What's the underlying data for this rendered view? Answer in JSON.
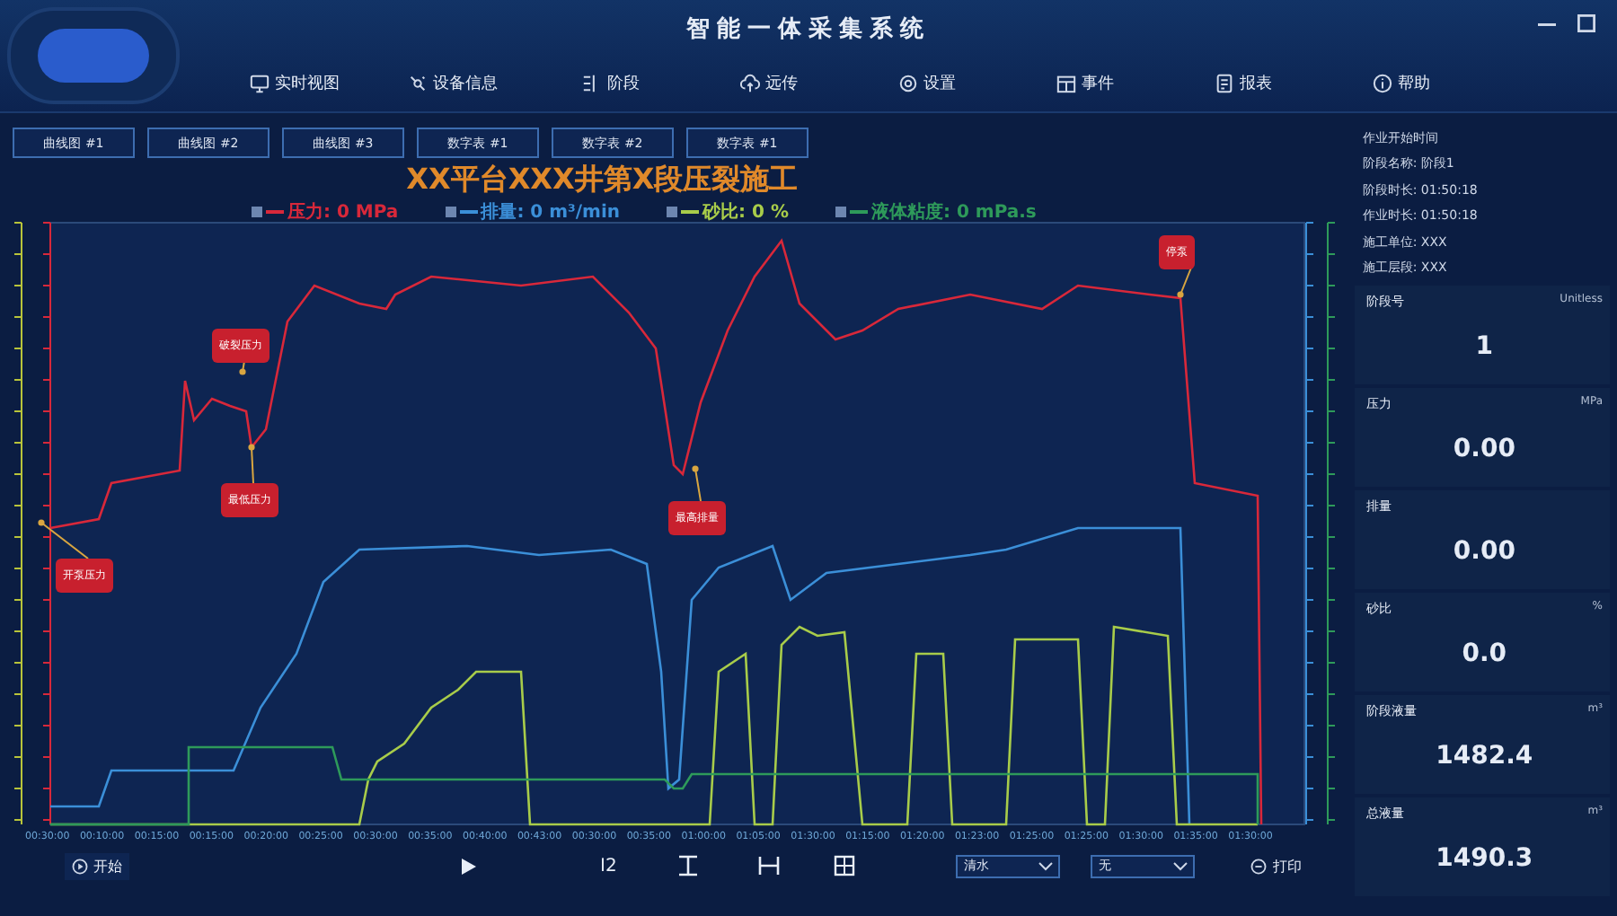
{
  "window": {
    "title": "智能一体采集系统"
  },
  "nav": [
    {
      "label": "实时视图",
      "selected": false
    },
    {
      "label": "设备信息",
      "selected": false
    },
    {
      "label": "阶段",
      "selected": false
    },
    {
      "label": "远传",
      "selected": false
    },
    {
      "label": "设置",
      "selected": false
    },
    {
      "label": "事件",
      "selected": false
    },
    {
      "label": "报表",
      "selected": false
    },
    {
      "label": "帮助",
      "selected": false
    }
  ],
  "tabs": [
    {
      "label": "曲线图 #1",
      "selected": false
    },
    {
      "label": "曲线图 #2",
      "selected": false
    },
    {
      "label": "曲线图 #3",
      "selected": false
    },
    {
      "label": "数字表 #1",
      "selected": false
    },
    {
      "label": "数字表 #2",
      "selected": false
    },
    {
      "label": "数字表 #1",
      "selected": false
    }
  ],
  "chart": {
    "title": "XX平台XXX井第X段压裂施工",
    "legend": [
      {
        "label": "压力: 0 MPa",
        "color": "#d8283a"
      },
      {
        "label": "排量: 0 m³/min",
        "color": "#3b8fd8"
      },
      {
        "label": "砂比: 0 %",
        "color": "#a8cc4a"
      },
      {
        "label": "液体粘度: 0 mPa.s",
        "color": "#2e9a5a"
      }
    ],
    "annotations": [
      "开泵压力",
      "破裂压力",
      "最低压力",
      "最高排量",
      "停泵"
    ],
    "x_labels": [
      "00:30:00",
      "00:10:00",
      "00:15:00",
      "00:15:00",
      "00:20:00",
      "00:25:00",
      "00:30:00",
      "00:35:00",
      "00:40:00",
      "00:43:00",
      "00:30:00",
      "00:35:00",
      "01:00:00",
      "01:05:00",
      "01:30:00",
      "01:15:00",
      "01:20:00",
      "01:23:00",
      "01:25:00",
      "01:25:00",
      "01:30:00",
      "01:35:00",
      "01:30:00"
    ]
  },
  "toolbar": {
    "start": "开始",
    "zoom_label": "I2",
    "fluid": "清水",
    "proppant": "无",
    "print": "打印"
  },
  "info": [
    "作业开始时间",
    "阶段名称: 阶段1",
    "阶段时长: 01:50:18",
    "作业时长: 01:50:18",
    "施工单位: XXX",
    "施工层段: XXX"
  ],
  "cards": [
    {
      "label": "阶段号",
      "unit": "Unitless",
      "value": "1"
    },
    {
      "label": "压力",
      "unit": "MPa",
      "value": "0.00"
    },
    {
      "label": "排量",
      "value": "0.00"
    },
    {
      "label": "砂比",
      "unit": "%",
      "value": "0.0"
    },
    {
      "label": "阶段液量",
      "unit": "m³",
      "value": "1482.4"
    },
    {
      "label": "总液量",
      "unit": "m³",
      "value": "1490.3"
    }
  ]
}
